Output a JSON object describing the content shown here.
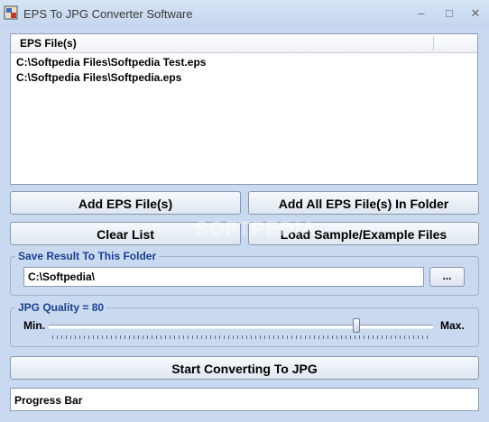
{
  "window": {
    "title": "EPS To JPG Converter Software",
    "minimize": "–",
    "restore": "□",
    "close": "✕"
  },
  "file_list": {
    "header": "EPS File(s)",
    "items": [
      "C:\\Softpedia Files\\Softpedia Test.eps",
      "C:\\Softpedia Files\\Softpedia.eps"
    ]
  },
  "buttons": {
    "add_files": "Add EPS File(s)",
    "add_folder": "Add All EPS File(s) In Folder",
    "clear_list": "Clear List",
    "load_samples": "Load Sample/Example Files",
    "browse": "...",
    "start": "Start Converting To JPG"
  },
  "output_folder": {
    "label": "Save Result To This Folder",
    "value": "C:\\Softpedia\\"
  },
  "quality": {
    "label": "JPG Quality = 80",
    "min_label": "Min.",
    "max_label": "Max.",
    "value": 80,
    "min": 0,
    "max": 100
  },
  "progress": {
    "label": "Progress Bar"
  },
  "watermark": "SOFTPEDIA",
  "colors": {
    "background": "#c9d9ef",
    "group_label": "#1b3f8f"
  }
}
